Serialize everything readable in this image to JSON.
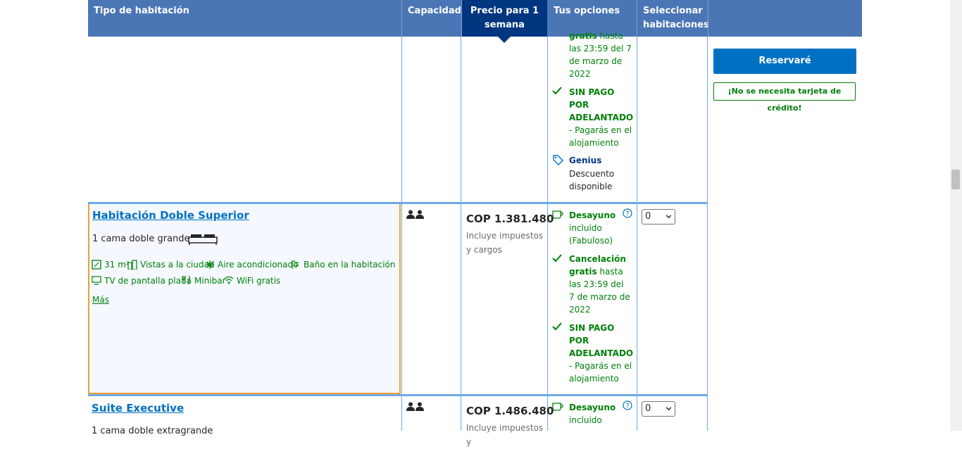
{
  "header": {
    "room_type": "Tipo de habitación",
    "capacity": "Capacidad",
    "price": "Precio para 1 semana",
    "options": "Tus opciones",
    "select": "Seleccionar habitaciones"
  },
  "first_row": {
    "cancel_tail": "gratis",
    "cancel_tail_rest": " hasta",
    "cancel_date": "las 23:59 del 7 de marzo de 2022",
    "no_prepay": "SIN PAGO POR ADELANTADO",
    "no_prepay_note": "- Pagarás en el alojamiento",
    "genius": "Genius",
    "genius_note": "Descuento disponible"
  },
  "sidebar": {
    "reserve_button": "Reservaré",
    "no_card": "¡No se necesita tarjeta de crédito!"
  },
  "rooms": [
    {
      "title": "Habitación Doble Superior",
      "bed": "1 cama doble grande",
      "features": [
        "31 m²",
        "Vistas a la ciudad",
        "Aire acondicionado",
        "Baño en la habitación",
        "TV de pantalla plana",
        "Minibar",
        "WiFi gratis"
      ],
      "more": "Más",
      "price": "COP 1.381.480",
      "price_note": "Incluye impuestos y cargos",
      "breakfast": "Desayuno",
      "breakfast_note": "incluido (Fabuloso)",
      "cancel": "Cancelación gratis",
      "cancel_rest": " hasta las 23:59 del 7 de marzo de 2022",
      "no_prepay": "SIN PAGO POR ADELANTADO",
      "no_prepay_note": "- Pagarás en el alojamiento",
      "select_value": "0"
    },
    {
      "title": "Suite Executive",
      "bed": "1 cama doble extragrande",
      "price": "COP 1.486.480",
      "price_note": "Incluye impuestos y",
      "breakfast": "Desayuno",
      "breakfast_note": "incluido",
      "select_value": "0"
    }
  ]
}
